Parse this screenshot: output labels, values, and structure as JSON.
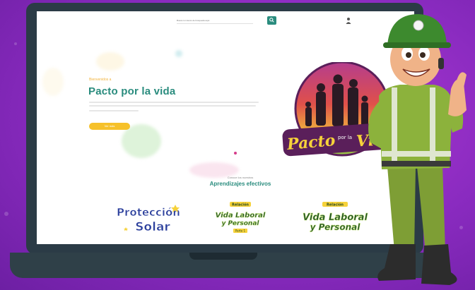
{
  "site": {
    "search_placeholder": "Busca tu interés de búsqueda aquí",
    "search_button_icon": "search-icon",
    "user_icon": "user-icon"
  },
  "hero": {
    "kicker": "Bienvenidos a",
    "title": "Pacto por la vida",
    "button_label": "Ver más"
  },
  "logo": {
    "text_left": "Pacto",
    "text_mid": "por la",
    "text_right": "Vida"
  },
  "section": {
    "subtitle": "Conoce los nuestros",
    "title": "Aprendizajes efectivos"
  },
  "cards": [
    {
      "line1": "Protección",
      "line2": "Solar"
    },
    {
      "badge": "Relación",
      "line1": "Vida Laboral",
      "line2": "y Personal",
      "tag": "Parte 1"
    },
    {
      "badge": "Relación",
      "line1": "Vida Laboral",
      "line2": "y Personal"
    }
  ],
  "colors": {
    "background": "#9b2fcc",
    "accent": "#2a8c7e",
    "button": "#f6c12a",
    "laptop": "#2b3b46"
  }
}
